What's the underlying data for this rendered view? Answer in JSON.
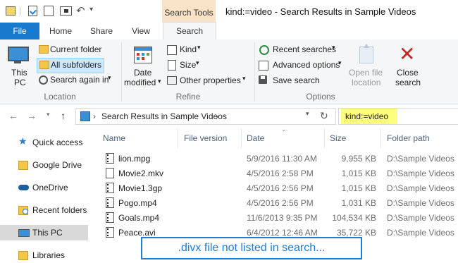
{
  "titlebar": {
    "context_tab": "Search Tools",
    "title": "kind:=video - Search Results in Sample Videos"
  },
  "ribbon_tabs": {
    "file": "File",
    "home": "Home",
    "share": "Share",
    "view": "View",
    "search": "Search"
  },
  "ribbon": {
    "location": {
      "this_pc": "This PC",
      "this_pc_line1": "This",
      "this_pc_line2": "PC",
      "current_folder": "Current folder",
      "all_subfolders": "All subfolders",
      "search_again_in": "Search again in",
      "group_label": "Location"
    },
    "refine": {
      "date_modified_line1": "Date",
      "date_modified_line2": "modified",
      "kind": "Kind",
      "size": "Size",
      "other_properties": "Other properties",
      "group_label": "Refine"
    },
    "options": {
      "recent_searches": "Recent searches",
      "advanced_options": "Advanced options",
      "save_search": "Save search",
      "open_file_location_line1": "Open file",
      "open_file_location_line2": "location",
      "close_search_line1": "Close",
      "close_search_line2": "search",
      "group_label": "Options"
    }
  },
  "address": {
    "path": "Search Results in Sample Videos",
    "search_value": "kind:=video"
  },
  "nav_pane": {
    "items": [
      {
        "label": "Quick access",
        "icon": "star-icon"
      },
      {
        "label": "Google Drive",
        "icon": "folder-icon"
      },
      {
        "label": "OneDrive",
        "icon": "cloud-icon"
      },
      {
        "label": "Recent folders",
        "icon": "recent-folders-icon"
      },
      {
        "label": "This PC",
        "icon": "pc-icon"
      },
      {
        "label": "Libraries",
        "icon": "libraries-icon"
      }
    ]
  },
  "columns": {
    "name": "Name",
    "file_version": "File version",
    "date": "Date",
    "size": "Size",
    "folder_path": "Folder path"
  },
  "files": [
    {
      "name": "lion.mpg",
      "date": "5/9/2016 11:30 AM",
      "size": "9,955 KB",
      "path": "D:\\Sample Videos"
    },
    {
      "name": "Movie2.mkv",
      "date": "4/5/2016 2:58 PM",
      "size": "1,015 KB",
      "path": "D:\\Sample Videos"
    },
    {
      "name": "Movie1.3gp",
      "date": "4/5/2016 2:56 PM",
      "size": "1,015 KB",
      "path": "D:\\Sample Videos"
    },
    {
      "name": "Pogo.mp4",
      "date": "4/5/2016 2:56 PM",
      "size": "1,031 KB",
      "path": "D:\\Sample Videos"
    },
    {
      "name": "Goals.mp4",
      "date": "11/6/2013 9:35 PM",
      "size": "104,534 KB",
      "path": "D:\\Sample Videos"
    },
    {
      "name": "Peace.avi",
      "date": "6/4/2012 12:46 AM",
      "size": "35,722 KB",
      "path": "D:\\Sample Videos"
    }
  ],
  "callout": ".divx file not listed in search...",
  "colors": {
    "file_tab": "#1979ca",
    "context_tab": "#f9e3c8",
    "search_highlight": "#fdfd7e",
    "callout": "#1f7dd8"
  }
}
